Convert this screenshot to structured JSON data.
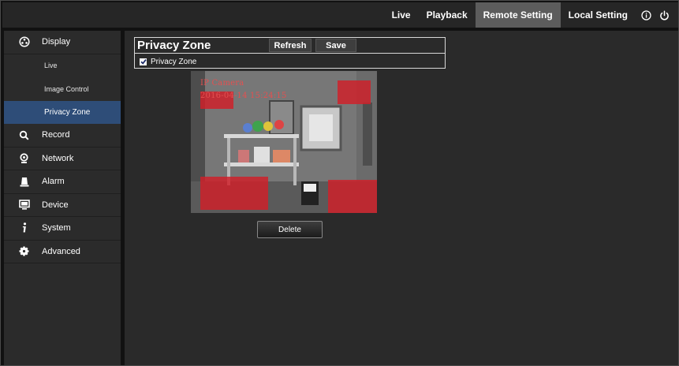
{
  "topnav": {
    "items": [
      {
        "label": "Live",
        "active": false
      },
      {
        "label": "Playback",
        "active": false
      },
      {
        "label": "Remote Setting",
        "active": true
      },
      {
        "label": "Local Setting",
        "active": false
      }
    ],
    "icons": [
      "info-icon",
      "power-icon"
    ]
  },
  "sidebar": {
    "display": {
      "label": "Display",
      "icon": "display-icon"
    },
    "sub_items": [
      {
        "label": "Live",
        "active": false
      },
      {
        "label": "Image Control",
        "active": false
      },
      {
        "label": "Privacy Zone",
        "active": true
      }
    ],
    "items": [
      {
        "label": "Record",
        "icon": "search-icon"
      },
      {
        "label": "Network",
        "icon": "network-icon"
      },
      {
        "label": "Alarm",
        "icon": "alarm-icon"
      },
      {
        "label": "Device",
        "icon": "device-icon"
      },
      {
        "label": "System",
        "icon": "info-icon"
      },
      {
        "label": "Advanced",
        "icon": "gear-icon"
      }
    ]
  },
  "main": {
    "title": "Privacy Zone",
    "refresh_label": "Refresh",
    "save_label": "Save",
    "privacy_checkbox": {
      "label": "Privacy Zone",
      "checked": true
    },
    "preview": {
      "camera_name": "IP Camera",
      "timestamp": "2016-04-14 15:24:15"
    },
    "delete_label": "Delete"
  },
  "colors": {
    "active_nav": "#5c5c5c",
    "active_submenu": "#2e4d78",
    "privacy_zone": "#d21e28",
    "osd_text": "#e35050"
  }
}
